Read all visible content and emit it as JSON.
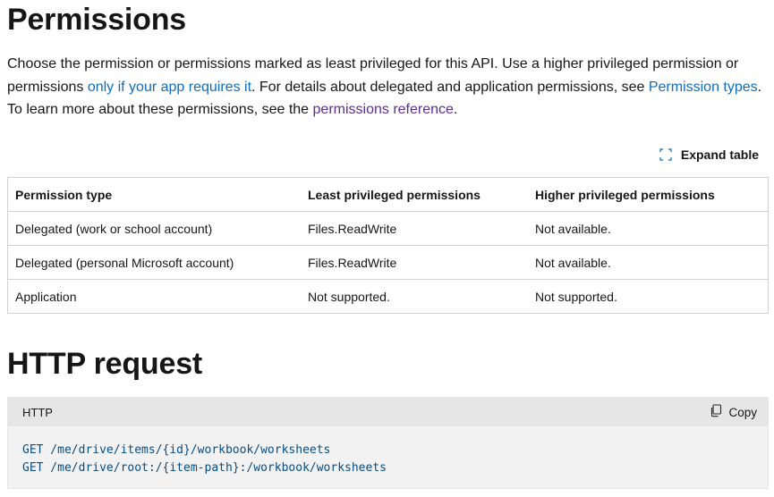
{
  "permissions_section": {
    "title": "Permissions",
    "intro": {
      "p1": "Choose the permission or permissions marked as least privileged for this API. Use a higher privileged permission or permissions ",
      "link1": "only if your app requires it",
      "p2": ". For details about delegated and application permissions, see ",
      "link2": "Permission types",
      "p3": ". To learn more about these permissions, see the ",
      "link3": "permissions reference",
      "p4": "."
    },
    "expand_label": "Expand table",
    "table": {
      "headers": [
        "Permission type",
        "Least privileged permissions",
        "Higher privileged permissions"
      ],
      "rows": [
        [
          "Delegated (work or school account)",
          "Files.ReadWrite",
          "Not available."
        ],
        [
          "Delegated (personal Microsoft account)",
          "Files.ReadWrite",
          "Not available."
        ],
        [
          "Application",
          "Not supported.",
          "Not supported."
        ]
      ]
    }
  },
  "http_section": {
    "title": "HTTP request",
    "code_lang": "HTTP",
    "copy_label": "Copy",
    "code_lines": [
      "GET /me/drive/items/{id}/workbook/worksheets",
      "GET /me/drive/root:/{item-path}:/workbook/worksheets"
    ]
  },
  "colors": {
    "link": "#0f6cbd",
    "visited_link": "#5c2e91",
    "code_text": "#0a4c80",
    "code_background": "#f2f2f2",
    "code_header": "#e6e6e6",
    "border": "#d1d1d1"
  },
  "icons": {
    "expand": "expand-icon",
    "copy": "copy-icon"
  }
}
